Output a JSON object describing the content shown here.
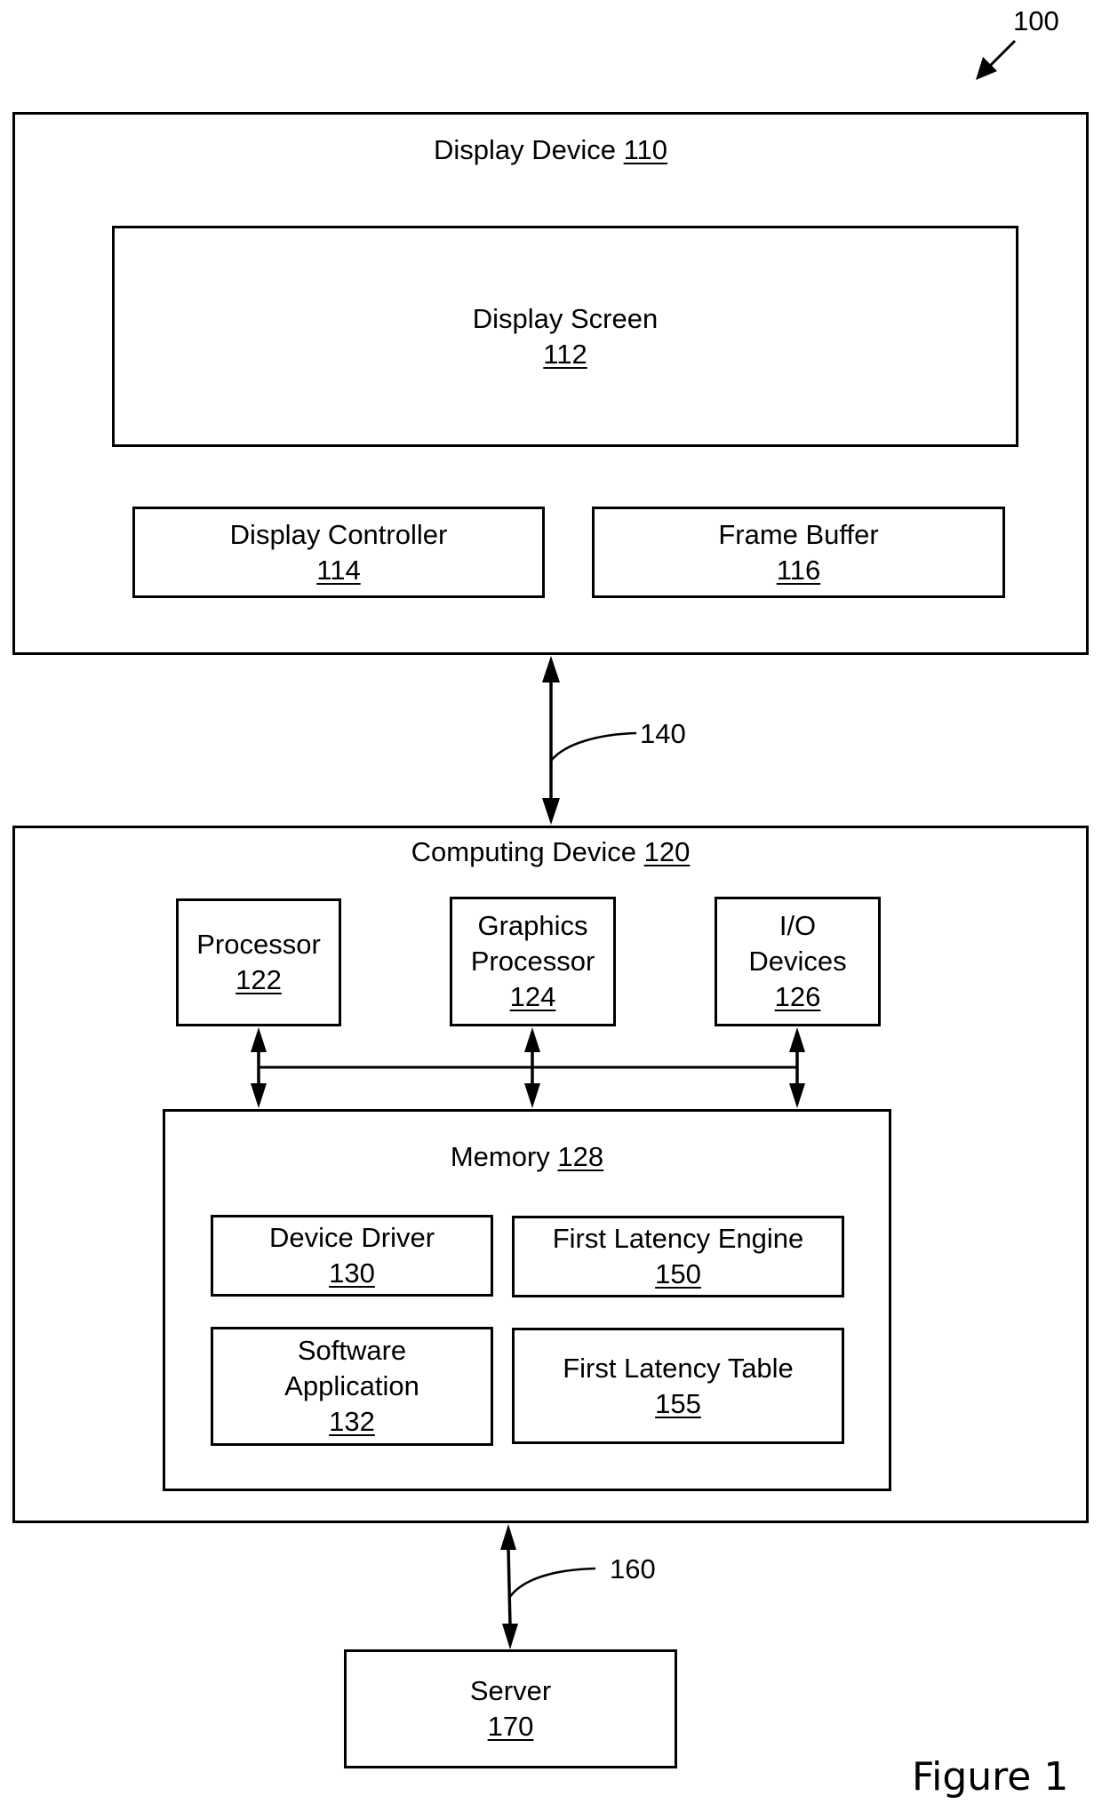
{
  "figure_ref": "100",
  "figure_caption": "Figure 1",
  "display_device": {
    "title": "Display Device",
    "num": "110",
    "display_screen": {
      "title": "Display Screen",
      "num": "112"
    },
    "display_controller": {
      "title": "Display Controller",
      "num": "114"
    },
    "frame_buffer": {
      "title": "Frame Buffer",
      "num": "116"
    }
  },
  "link_140": "140",
  "computing_device": {
    "title": "Computing Device",
    "num": "120",
    "processor": {
      "title": "Processor",
      "num": "122"
    },
    "graphics_processor": {
      "line1": "Graphics",
      "line2": "Processor",
      "num": "124"
    },
    "io_devices": {
      "line1": "I/O",
      "line2": "Devices",
      "num": "126"
    },
    "memory": {
      "title": "Memory",
      "num": "128",
      "device_driver": {
        "title": "Device Driver",
        "num": "130"
      },
      "first_latency_engine": {
        "title": "First Latency Engine",
        "num": "150"
      },
      "software_application": {
        "line1": "Software",
        "line2": "Application",
        "num": "132"
      },
      "first_latency_table": {
        "title": "First Latency Table",
        "num": "155"
      }
    }
  },
  "link_160": "160",
  "server": {
    "title": "Server",
    "num": "170"
  }
}
